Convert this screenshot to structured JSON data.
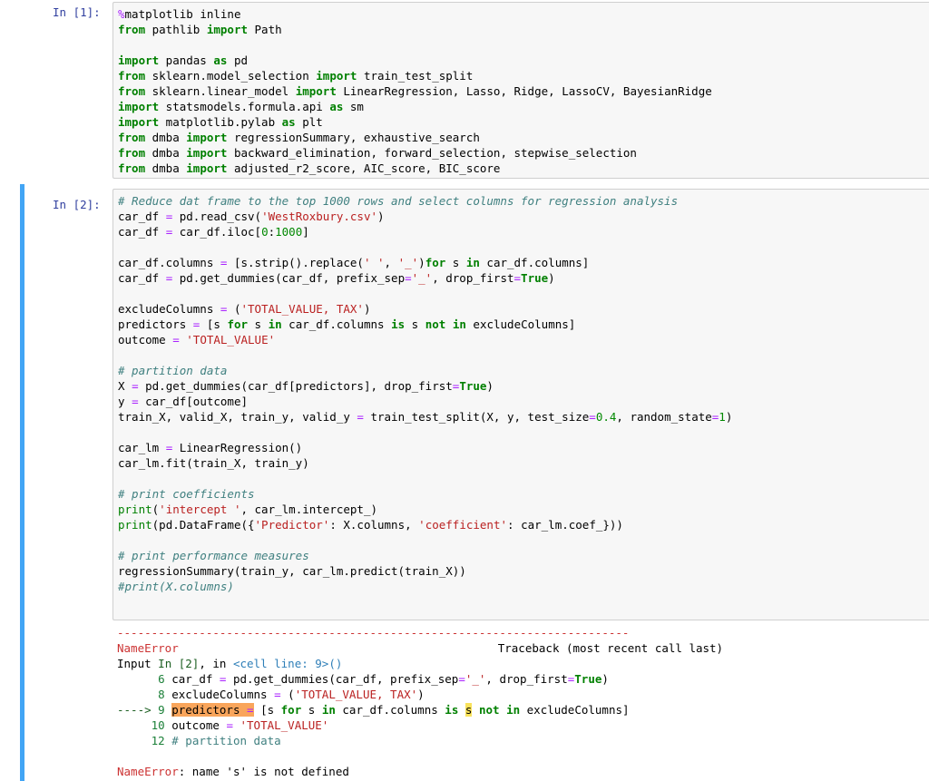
{
  "cell1": {
    "prompt": "In [1]:",
    "lines": [
      "%matplotlib inline",
      "from pathlib import Path",
      "",
      "import pandas as pd",
      "from sklearn.model_selection import train_test_split",
      "from sklearn.linear_model import LinearRegression, Lasso, Ridge, LassoCV, BayesianRidge",
      "import statsmodels.formula.api as sm",
      "import matplotlib.pylab as plt",
      "from dmba import regressionSummary, exhaustive_search",
      "from dmba import backward_elimination, forward_selection, stepwise_selection",
      "from dmba import adjusted_r2_score, AIC_score, BIC_score"
    ]
  },
  "cell2": {
    "prompt": "In [2]:",
    "lines": [
      "# Reduce dat frame to the top 1000 rows and select columns for regression analysis",
      "car_df = pd.read_csv('WestRoxbury.csv')",
      "car_df = car_df.iloc[0:1000]",
      "",
      "car_df.columns = [s.strip().replace(' ', '_')for s in car_df.columns]",
      "car_df = pd.get_dummies(car_df, prefix_sep='_', drop_first=True)",
      "",
      "excludeColumns = ('TOTAL_VALUE, TAX')",
      "predictors = [s for s in car_df.columns is s not in excludeColumns]",
      "outcome = 'TOTAL_VALUE'",
      "",
      "# partition data",
      "X = pd.get_dummies(car_df[predictors], drop_first=True)",
      "y = car_df[outcome]",
      "train_X, valid_X, train_y, valid_y = train_test_split(X, y, test_size=0.4, random_state=1)",
      "",
      "car_lm = LinearRegression()",
      "car_lm.fit(train_X, train_y)",
      "",
      "# print coefficients",
      "print('intercept ', car_lm.intercept_)",
      "print(pd.DataFrame({'Predictor': X.columns, 'coefficient': car_lm.coef_}))",
      "",
      "# print performance measures",
      "regressionSummary(train_y, car_lm.predict(train_X))",
      "#print(X.columns)"
    ],
    "output": {
      "separator": "---------------------------------------------------------------------------",
      "error_name": "NameError",
      "traceback_label": "Traceback (most recent call last)",
      "input_label": "Input",
      "input_ref": "In [2]",
      "in_text": ", in ",
      "cell_line": "<cell line: 9>()",
      "tb_lines": [
        {
          "prefix": "      ",
          "no": "6",
          "code": " car_df = pd.get_dummies(car_df, prefix_sep='_', drop_first=True)"
        },
        {
          "prefix": "      ",
          "no": "8",
          "code": " excludeColumns = ('TOTAL_VALUE, TAX')"
        },
        {
          "prefix": "----> ",
          "no": "9",
          "code": " predictors = [s for s in car_df.columns is s not in excludeColumns]"
        },
        {
          "prefix": "     ",
          "no": "10",
          "code": " outcome = 'TOTAL_VALUE'"
        },
        {
          "prefix": "     ",
          "no": "12",
          "code": " # partition data"
        }
      ],
      "final_error_name": "NameError",
      "final_error_msg": ": name 's' is not defined"
    }
  }
}
